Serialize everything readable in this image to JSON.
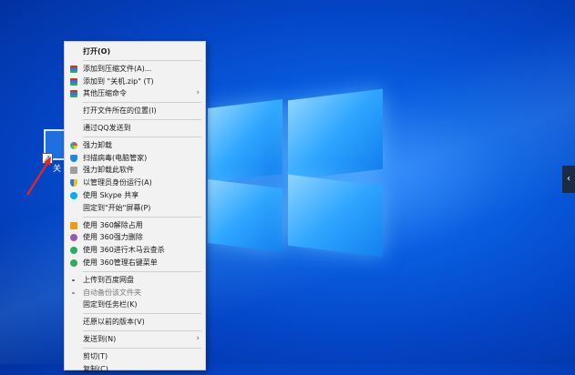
{
  "desktop": {
    "icon_label": "关",
    "side_tab_glyph": "‹"
  },
  "colors": {
    "accent": "#0a5ee0",
    "menu_bg": "#f2f2f2"
  },
  "menu": {
    "open": "打开(O)",
    "add_archive": "添加到压缩文件(A)...",
    "add_zip": "添加到 \"关机.zip\" (T)",
    "other_compress": "其他压缩命令",
    "open_location": "打开文件所在的位置(I)",
    "send_qq": "通过QQ发送到",
    "force_uninstall": "强力卸载",
    "scan_virus": "扫描病毒(电脑管家)",
    "force_uninstall_software": "强力卸载此软件",
    "run_as_admin": "以管理员身份运行(A)",
    "skype_share": "使用 Skype 共享",
    "pin_start": "固定到\"开始\"屏幕(P)",
    "unlock_360": "使用 360解除占用",
    "delete_360": "使用 360强力删除",
    "trojan_scan_360": "使用 360进行木马云查杀",
    "manage_menu_360": "使用 360管理右键菜单",
    "upload_baidu": "上传到百度网盘",
    "auto_backup": "自动备份该文件夹",
    "pin_taskbar": "固定到任务栏(K)",
    "restore_version": "还原以前的版本(V)",
    "send_to": "发送到(N)",
    "cut": "剪切(T)",
    "copy": "复制(C)",
    "submenu_arrow": "›"
  }
}
